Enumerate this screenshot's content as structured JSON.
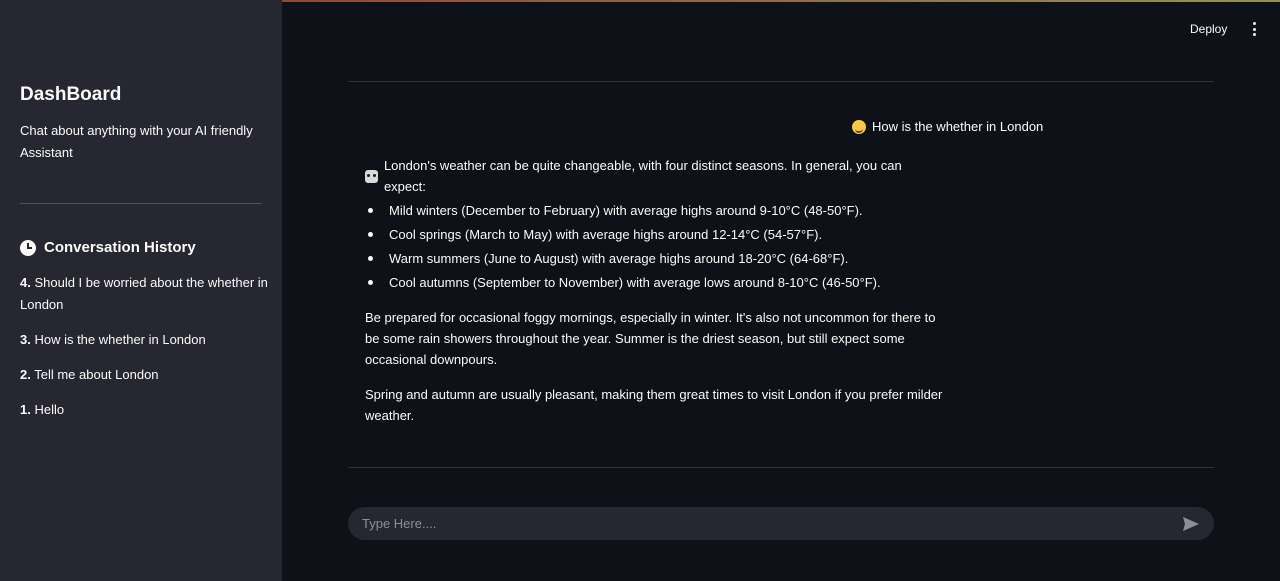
{
  "sidebar": {
    "title": "DashBoard",
    "subtitle": "Chat about anything with your AI friendly Assistant",
    "history_heading": "Conversation History",
    "history": [
      {
        "num": "4.",
        "text": " Should I be worried about the whether in London"
      },
      {
        "num": "3.",
        "text": " How is the whether in London"
      },
      {
        "num": "2.",
        "text": " Tell me about London"
      },
      {
        "num": "1.",
        "text": " Hello"
      }
    ]
  },
  "header": {
    "deploy_label": "Deploy"
  },
  "chat": {
    "user_message": "How is the whether in London",
    "assistant_intro": "London's weather can be quite changeable, with four distinct seasons. In general, you can expect:",
    "bullets": [
      "Mild winters (December to February) with average highs around 9-10°C (48-50°F).",
      "Cool springs (March to May) with average highs around 12-14°C (54-57°F).",
      "Warm summers (June to August) with average highs around 18-20°C (64-68°F).",
      "Cool autumns (September to November) with average lows around 8-10°C (46-50°F)."
    ],
    "paragraph1": "Be prepared for occasional foggy mornings, especially in winter. It's also not uncommon for there to be some rain showers throughout the year. Summer is the driest season, but still expect some occasional downpours.",
    "paragraph2": "Spring and autumn are usually pleasant, making them great times to visit London if you prefer milder weather."
  },
  "input": {
    "placeholder": "Type Here...."
  },
  "icons": {
    "history": "clock-icon",
    "user": "user-avatar-icon",
    "assistant": "bot-icon",
    "send": "send-icon",
    "menu": "kebab-menu-icon"
  },
  "colors": {
    "background": "#0e1117",
    "sidebar": "#262730",
    "text": "#fafafa",
    "input_bg": "#262730"
  }
}
